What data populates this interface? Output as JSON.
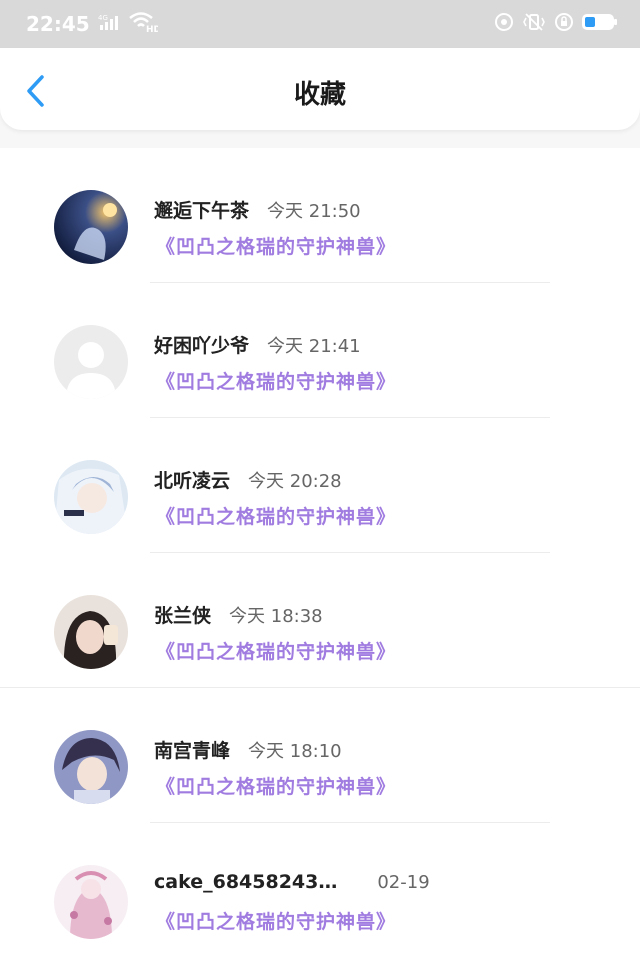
{
  "status_bar": {
    "time": "22:45",
    "network": "4G",
    "wifi_badge": "HD"
  },
  "header": {
    "title": "收藏",
    "back_icon": "chevron-left-icon",
    "accent_color": "#2e9cf5"
  },
  "items": [
    {
      "name": "邂逅下午茶",
      "time": "今天 21:50",
      "book": "《凹凸之格瑞的守护神兽》"
    },
    {
      "name": "好困吖少爷",
      "time": "今天 21:41",
      "book": "《凹凸之格瑞的守护神兽》"
    },
    {
      "name": "北听凌云",
      "time": "今天 20:28",
      "book": "《凹凸之格瑞的守护神兽》"
    },
    {
      "name": "张兰侠",
      "time": "今天 18:38",
      "book": "《凹凸之格瑞的守护神兽》"
    },
    {
      "name": "南宫青峰",
      "time": "今天 18:10",
      "book": "《凹凸之格瑞的守护神兽》"
    },
    {
      "name": "cake_68458243…",
      "time": "02-19",
      "book": "《凹凸之格瑞的守护神兽》"
    }
  ],
  "colors": {
    "book_title": "#a07ce0",
    "header_bg": "#ffffff",
    "status_bg": "#d9d9d9"
  }
}
